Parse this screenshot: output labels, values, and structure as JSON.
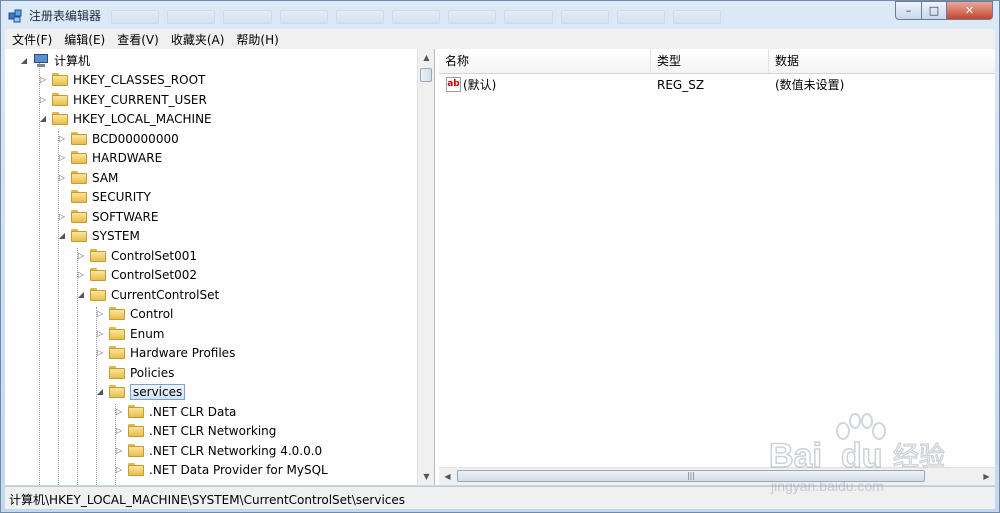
{
  "window": {
    "title": "注册表编辑器"
  },
  "titlebar": {
    "minimize": "–",
    "maximize": "□",
    "close": "✕"
  },
  "menu": [
    "文件(F)",
    "编辑(E)",
    "查看(V)",
    "收藏夹(A)",
    "帮助(H)"
  ],
  "tree": {
    "root": "计算机",
    "hkcr": "HKEY_CLASSES_ROOT",
    "hkcu": "HKEY_CURRENT_USER",
    "hklm": "HKEY_LOCAL_MACHINE",
    "bcd": "BCD00000000",
    "hardware": "HARDWARE",
    "sam": "SAM",
    "security": "SECURITY",
    "software": "SOFTWARE",
    "system": "SYSTEM",
    "cs001": "ControlSet001",
    "cs002": "ControlSet002",
    "ccs": "CurrentControlSet",
    "control": "Control",
    "enum": "Enum",
    "hwprofiles": "Hardware Profiles",
    "policies": "Policies",
    "services": "services",
    "clrdata": ".NET CLR Data",
    "clrnet": ".NET CLR Networking",
    "clrnet4": ".NET CLR Networking 4.0.0.0",
    "mysql": ".NET Data Provider for MySQL"
  },
  "list": {
    "headers": {
      "name": "名称",
      "type": "类型",
      "data": "数据"
    },
    "rows": [
      {
        "icon": "string-value-icon",
        "name": "(默认)",
        "type": "REG_SZ",
        "data": "(数值未设置)"
      }
    ]
  },
  "status": {
    "path": "计算机\\HKEY_LOCAL_MACHINE\\SYSTEM\\CurrentControlSet\\services"
  },
  "watermark": {
    "brand": "Bai",
    "brand2": "du",
    "cn": "经验",
    "url": "jingyan.baidu.com"
  },
  "colors": {
    "selection": "#cfe2f8",
    "folder": "#e7be4e",
    "titlebar": "#c3d7ee"
  }
}
